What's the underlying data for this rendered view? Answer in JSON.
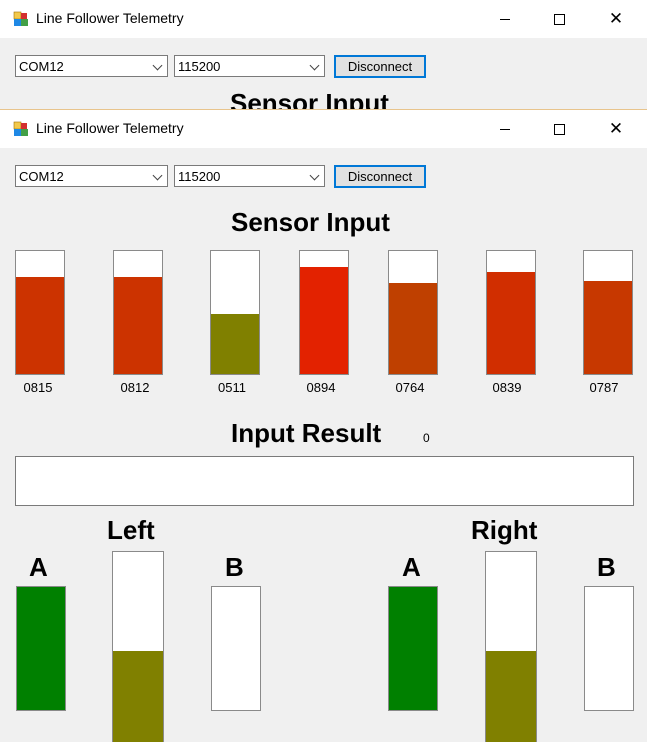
{
  "window": {
    "title": "Line Follower Telemetry"
  },
  "connection": {
    "port_value": "COM12",
    "baud_value": "115200",
    "disconnect_label": "Disconnect"
  },
  "sensor_section": {
    "heading": "Sensor Input",
    "sensors": [
      {
        "label": "0815",
        "level": 0.79,
        "color": "#cc3300"
      },
      {
        "label": "0812",
        "level": 0.79,
        "color": "#cc3300"
      },
      {
        "label": "0511",
        "level": 0.49,
        "color": "#808000"
      },
      {
        "label": "0894",
        "level": 0.87,
        "color": "#e32200"
      },
      {
        "label": "0764",
        "level": 0.74,
        "color": "#bf4000"
      },
      {
        "label": "0839",
        "level": 0.83,
        "color": "#d12e00"
      },
      {
        "label": "0787",
        "level": 0.76,
        "color": "#c73800"
      }
    ]
  },
  "result_section": {
    "heading": "Input Result",
    "count": "0",
    "value": ""
  },
  "motors": {
    "left": {
      "label": "Left",
      "a_label": "A",
      "b_label": "B",
      "a_level": 1.0,
      "center_level": 0.5,
      "b_level": 0.0
    },
    "right": {
      "label": "Right",
      "a_label": "A",
      "b_label": "B",
      "a_level": 1.0,
      "center_level": 0.5,
      "b_level": 0.0
    }
  },
  "colors": {
    "motor_a": "#008000",
    "motor_center": "#808000",
    "focus_border": "#0078d7"
  },
  "icons": [
    "app-icon",
    "minimize-icon",
    "maximize-icon",
    "close-icon",
    "chevron-down-icon"
  ]
}
